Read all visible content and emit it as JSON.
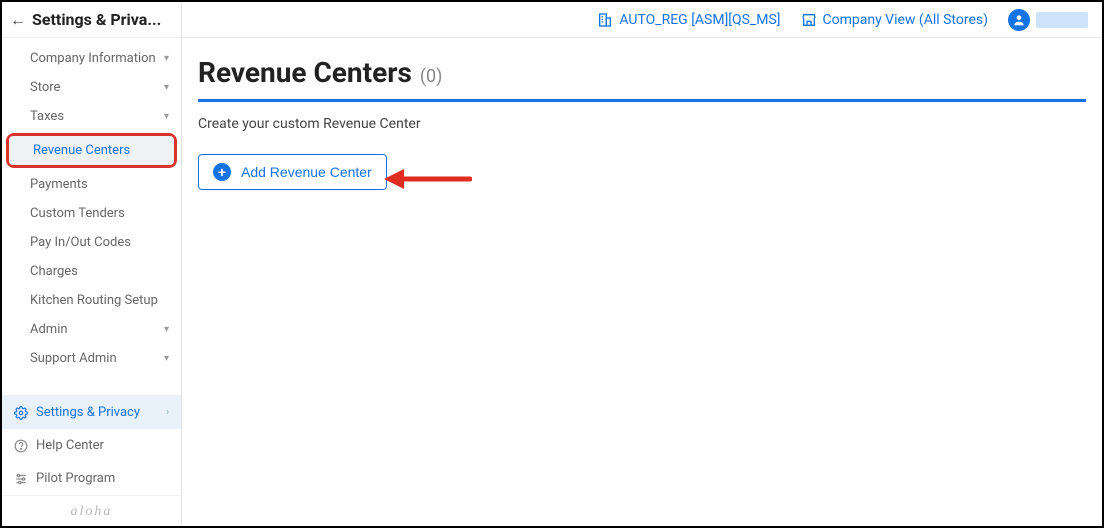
{
  "sidebar": {
    "header": "Settings & Priva...",
    "items": [
      {
        "label": "Company Information",
        "expandable": true
      },
      {
        "label": "Store",
        "expandable": true
      },
      {
        "label": "Taxes",
        "expandable": true
      },
      {
        "label": "Revenue Centers",
        "expandable": false,
        "selected": true,
        "highlighted": true
      },
      {
        "label": "Payments",
        "expandable": false
      },
      {
        "label": "Custom Tenders",
        "expandable": false
      },
      {
        "label": "Pay In/Out Codes",
        "expandable": false
      },
      {
        "label": "Charges",
        "expandable": false
      },
      {
        "label": "Kitchen Routing Setup",
        "expandable": false
      },
      {
        "label": "Admin",
        "expandable": true
      },
      {
        "label": "Support Admin",
        "expandable": true
      }
    ],
    "bottom": [
      {
        "icon": "gear",
        "label": "Settings & Privacy",
        "active": true,
        "chevron": true
      },
      {
        "icon": "help",
        "label": "Help Center"
      },
      {
        "icon": "sliders",
        "label": "Pilot Program"
      }
    ],
    "brand": "aloha"
  },
  "topbar": {
    "org_label": "AUTO_REG [ASM][QS_MS]",
    "view_label": "Company View (All Stores)"
  },
  "page": {
    "title": "Revenue Centers",
    "count": "(0)",
    "subtitle": "Create your custom Revenue Center",
    "add_button": "Add Revenue Center"
  }
}
